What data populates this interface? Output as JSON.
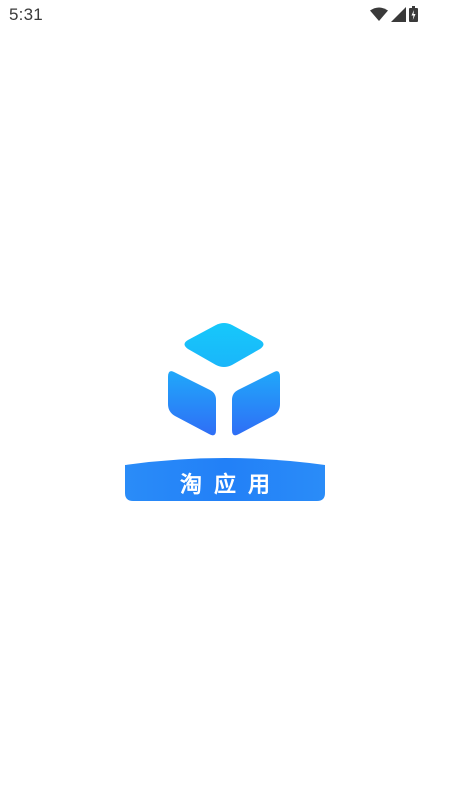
{
  "status_bar": {
    "time": "5:31",
    "icons": [
      "wifi-icon",
      "cellular-signal-icon",
      "battery-charging-icon"
    ]
  },
  "splash": {
    "app_name": "淘应用",
    "logo_icon": "cube-logo-icon"
  },
  "colors": {
    "background": "#ffffff",
    "brand_top": "#16c5fb",
    "brand_bottom": "#2f72f6",
    "status_text": "#3a3a3a"
  }
}
